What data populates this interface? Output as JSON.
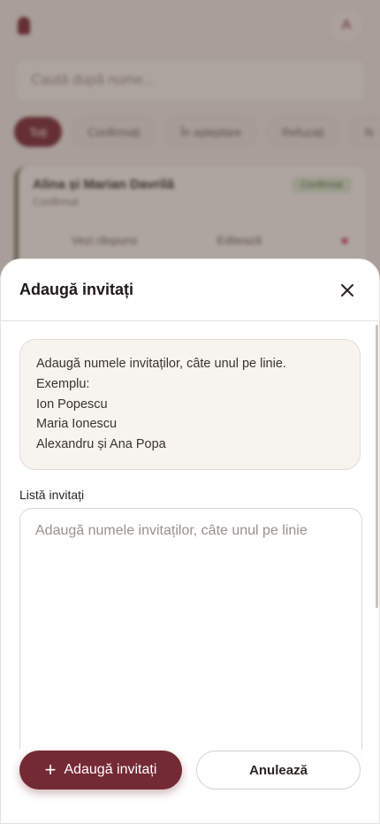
{
  "background": {
    "logo_text": "",
    "avatar_initial": "A",
    "search_placeholder": "Caută după nume...",
    "filters": [
      "Toți",
      "Confirmați",
      "În așteptare",
      "Refuzați",
      "N"
    ],
    "card": {
      "name": "Alina și Marian Davrilă",
      "status": "Confirmat",
      "badge": "Confirmat",
      "action_view": "Vezi răspuns",
      "action_edit": "Editează"
    }
  },
  "sheet": {
    "title": "Adaugă invitați",
    "close_icon": "close-icon",
    "hint_lines": [
      "Adaugă numele invitaților, câte unul pe linie.",
      "Exemplu:",
      "Ion Popescu",
      "Maria Ionescu",
      "Alexandru și Ana Popa"
    ],
    "list_label": "Listă invitați",
    "list_value": "",
    "list_placeholder": "Adaugă numele invitaților, câte unul pe linie",
    "primary_button": "Adaugă invitați",
    "secondary_button": "Anulează"
  },
  "colors": {
    "accent": "#742a35",
    "overlay": "#483832"
  }
}
